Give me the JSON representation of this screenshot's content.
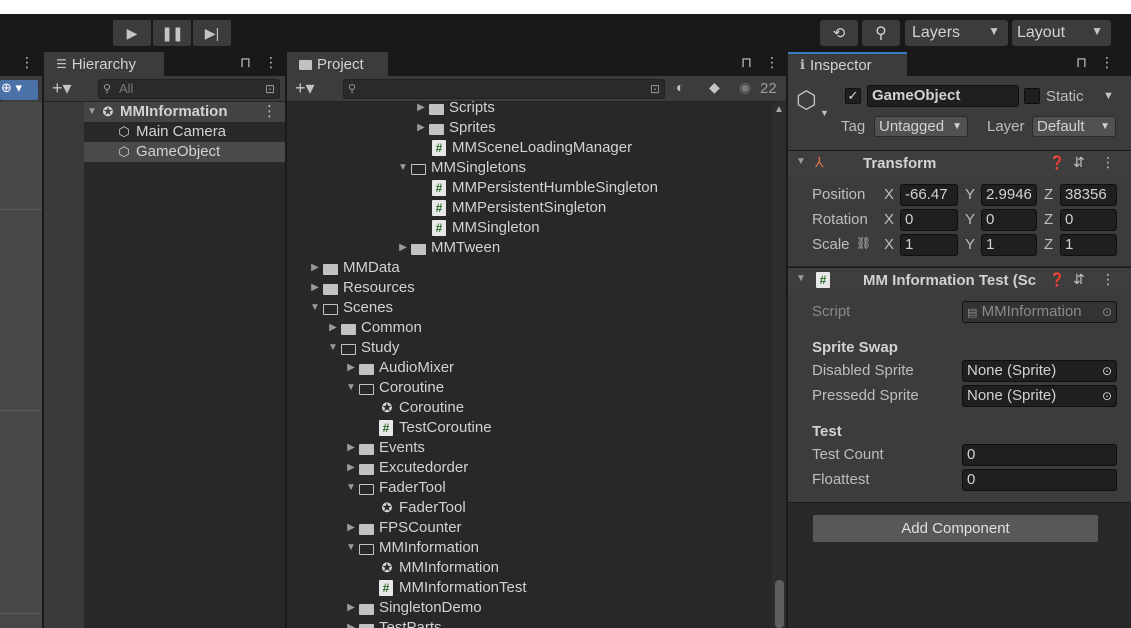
{
  "toolbar": {
    "play_icon": "play-icon",
    "pause_icon": "pause-icon",
    "step_icon": "step-icon",
    "history_icon": "history-icon",
    "search_icon": "search-icon",
    "layers_label": "Layers",
    "layout_label": "Layout"
  },
  "hierarchy": {
    "tab_label": "Hierarchy",
    "search_placeholder": "All",
    "items": [
      {
        "label": "MMInformation"
      },
      {
        "label": "Main Camera"
      },
      {
        "label": "GameObject"
      }
    ]
  },
  "project": {
    "tab_label": "Project",
    "visibility_count": "22",
    "items": [
      {
        "label": "Scripts"
      },
      {
        "label": "Sprites"
      },
      {
        "label": "MMSceneLoadingManager"
      },
      {
        "label": "MMSingletons"
      },
      {
        "label": "MMPersistentHumbleSingleton"
      },
      {
        "label": "MMPersistentSingleton"
      },
      {
        "label": "MMSingleton"
      },
      {
        "label": "MMTween"
      },
      {
        "label": "MMData"
      },
      {
        "label": "Resources"
      },
      {
        "label": "Scenes"
      },
      {
        "label": "Common"
      },
      {
        "label": "Study"
      },
      {
        "label": "AudioMixer"
      },
      {
        "label": "Coroutine"
      },
      {
        "label": "Coroutine"
      },
      {
        "label": "TestCoroutine"
      },
      {
        "label": "Events"
      },
      {
        "label": "Excutedorder"
      },
      {
        "label": "FaderTool"
      },
      {
        "label": "FaderTool"
      },
      {
        "label": "FPSCounter"
      },
      {
        "label": "MMInformation"
      },
      {
        "label": "MMInformation"
      },
      {
        "label": "MMInformationTest"
      },
      {
        "label": "SingletonDemo"
      },
      {
        "label": "TestParts"
      }
    ]
  },
  "inspector": {
    "tab_label": "Inspector",
    "object_name": "GameObject",
    "static_label": "Static",
    "tag_label": "Tag",
    "tag_value": "Untagged",
    "layer_label": "Layer",
    "layer_value": "Default",
    "transform": {
      "title": "Transform",
      "position_label": "Position",
      "rotation_label": "Rotation",
      "scale_label": "Scale",
      "x": "X",
      "y": "Y",
      "z": "Z",
      "position": [
        "-66.47",
        "2.9946",
        "38356"
      ],
      "rotation": [
        "0",
        "0",
        "0"
      ],
      "scale": [
        "1",
        "1",
        "1"
      ]
    },
    "component": {
      "title": "MM Information Test (Sc",
      "script_label": "Script",
      "script_value": "MMInformation",
      "header_sprite_swap": "Sprite Swap",
      "disabled_sprite_label": "Disabled Sprite",
      "disabled_sprite_value": "None (Sprite)",
      "pressed_sprite_label": "Pressedd Sprite",
      "pressed_sprite_value": "None (Sprite)",
      "header_test": "Test",
      "test_count_label": "Test Count",
      "test_count_value": "0",
      "floattest_label": "Floattest",
      "floattest_value": "0"
    },
    "add_component_label": "Add Component"
  }
}
